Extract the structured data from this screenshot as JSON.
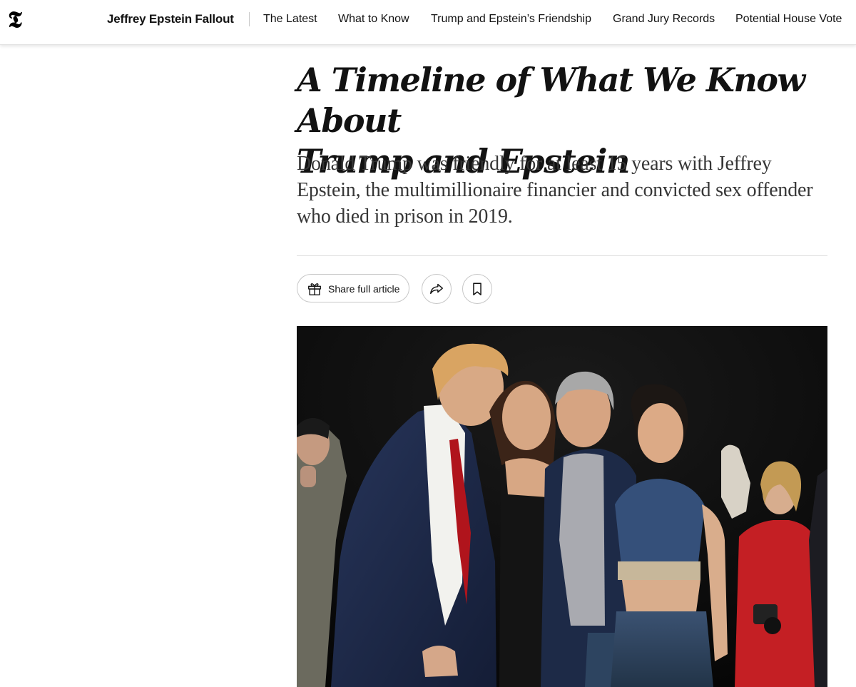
{
  "header": {
    "logo_glyph": "𝕿",
    "logo_icon": "nyt-logo-icon",
    "section_title": "Jeffrey Epstein Fallout",
    "nav": [
      "The Latest",
      "What to Know",
      "Trump and Epstein’s Friendship",
      "Grand Jury Records",
      "Potential House Vote"
    ]
  },
  "article": {
    "headline_line1": "A Timeline of What We Know About",
    "headline_line2": "Trump and Epstein",
    "summary": "Donald Trump was friendly for at least 15 years with Jeffrey Epstein, the multimillionaire financier and convicted sex offender who died in prison in 2019."
  },
  "actions": {
    "share_label": "Share full article",
    "share_icon": "gift-icon",
    "forward_icon": "share-arrow-icon",
    "bookmark_icon": "bookmark-icon"
  },
  "colors": {
    "text": "#121212",
    "summary_text": "#363636",
    "rule": "#dfdfdf",
    "button_border": "#c7c7c7",
    "photo_background": "#0b0b0b"
  }
}
